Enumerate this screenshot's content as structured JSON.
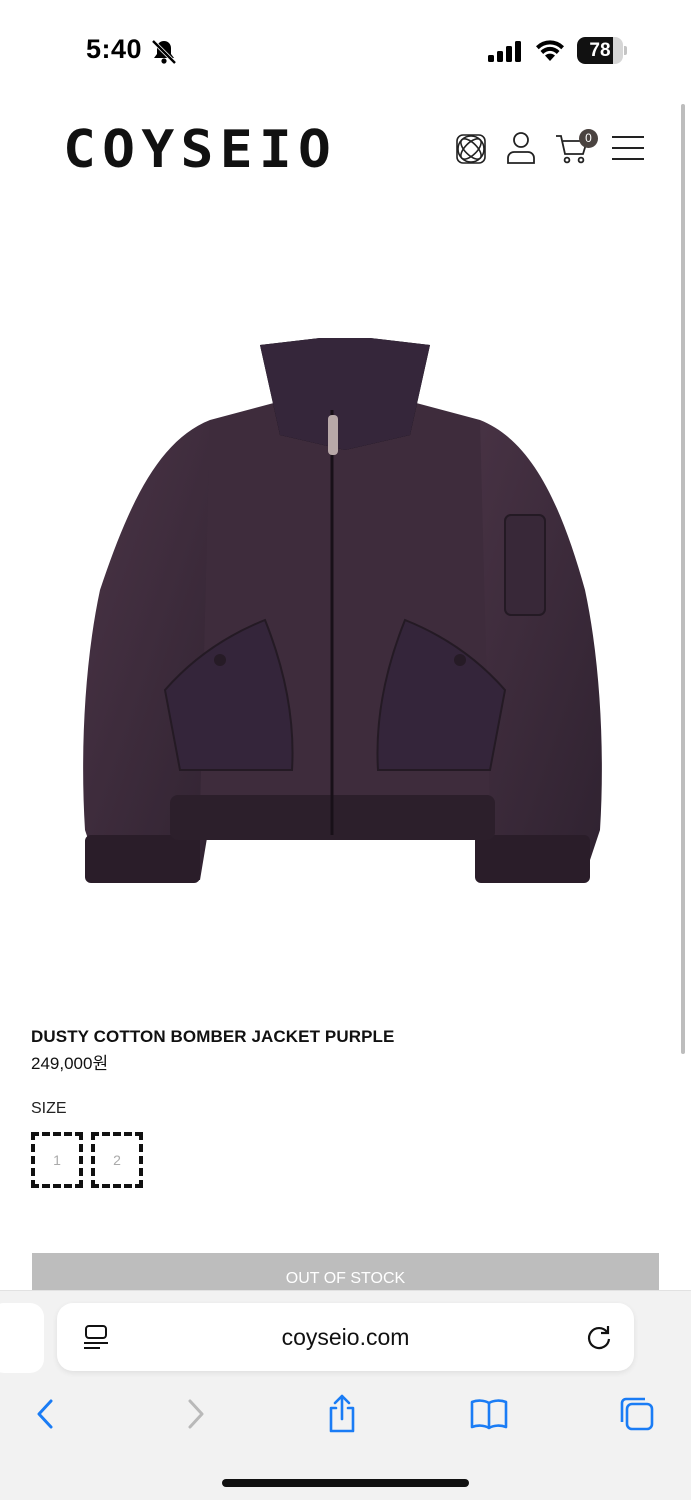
{
  "status_bar": {
    "time": "5:40",
    "battery_level": "78",
    "battery_fraction": 0.78
  },
  "header": {
    "logo": "COYSEIO",
    "cart_count": "0",
    "icons": [
      "globe-icon",
      "user-icon",
      "cart-icon",
      "menu-icon"
    ]
  },
  "product": {
    "name": "DUSTY COTTON BOMBER JACKET PURPLE",
    "price": "249,000원",
    "image_subject": "purple bomber jacket",
    "color": "#3d2a3a",
    "size_label": "SIZE",
    "sizes": [
      "1",
      "2"
    ],
    "stock_button": "OUT OF STOCK"
  },
  "browser": {
    "url": "coyseio.com",
    "icons": [
      "reader-icon",
      "reload-icon",
      "back-icon",
      "forward-icon",
      "share-icon",
      "bookmarks-icon",
      "tabs-icon"
    ],
    "accent": "#1a7cf5"
  }
}
